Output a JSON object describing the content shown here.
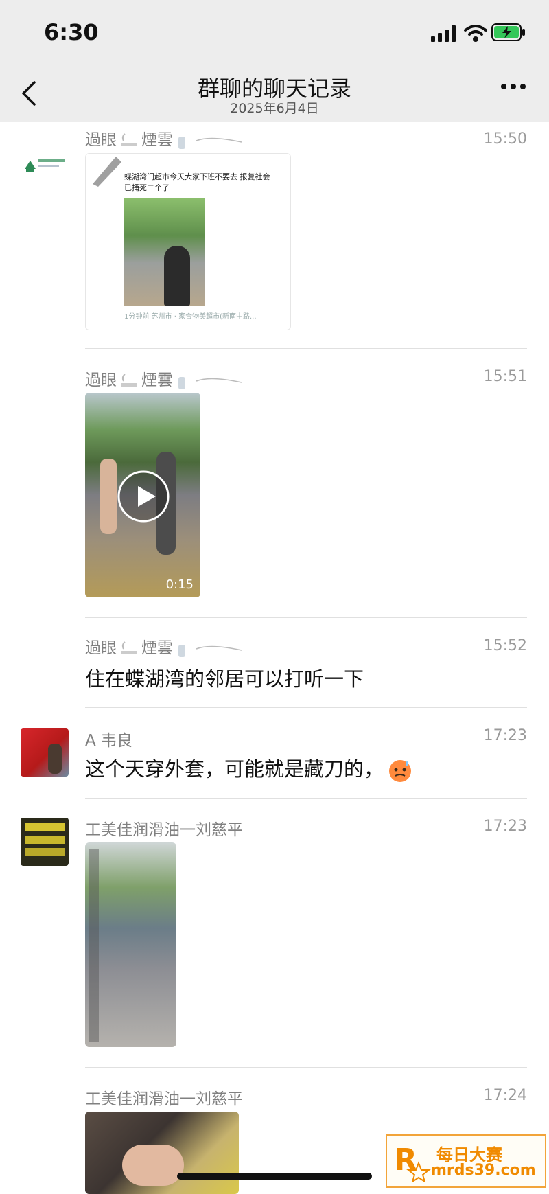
{
  "status_bar": {
    "time": "6:30"
  },
  "nav": {
    "title": "群聊的聊天记录",
    "subtitle": "2025年6月4日"
  },
  "messages": [
    {
      "sender": "過眼",
      "sender2": "煙雲",
      "time": "15:50",
      "type": "shared_card",
      "card": {
        "text": "蝶湖湾门超市今天大家下班不要去  报复社会 已捅死二个了",
        "meta": "1分钟前  苏州市 · 家合物美超市(新南中路..."
      }
    },
    {
      "sender": "過眼",
      "sender2": "煙雲",
      "time": "15:51",
      "type": "video",
      "duration": "0:15"
    },
    {
      "sender": "過眼",
      "sender2": "煙雲",
      "time": "15:52",
      "type": "text",
      "text": "住在蝶湖湾的邻居可以打听一下"
    },
    {
      "sender": "A 韦良",
      "time": "17:23",
      "type": "text",
      "text": "这个天穿外套，可能就是藏刀的，"
    },
    {
      "sender": "工美佳润滑油一刘慈平",
      "time": "17:23",
      "type": "image"
    },
    {
      "sender": "工美佳润滑油一刘慈平",
      "time": "17:24",
      "type": "image"
    }
  ],
  "watermark": {
    "title": "每日大赛",
    "url": "mrds39.com"
  },
  "colors": {
    "nav_bg": "#ededed",
    "accent_battery": "#34c759",
    "watermark": "#f08a00"
  }
}
